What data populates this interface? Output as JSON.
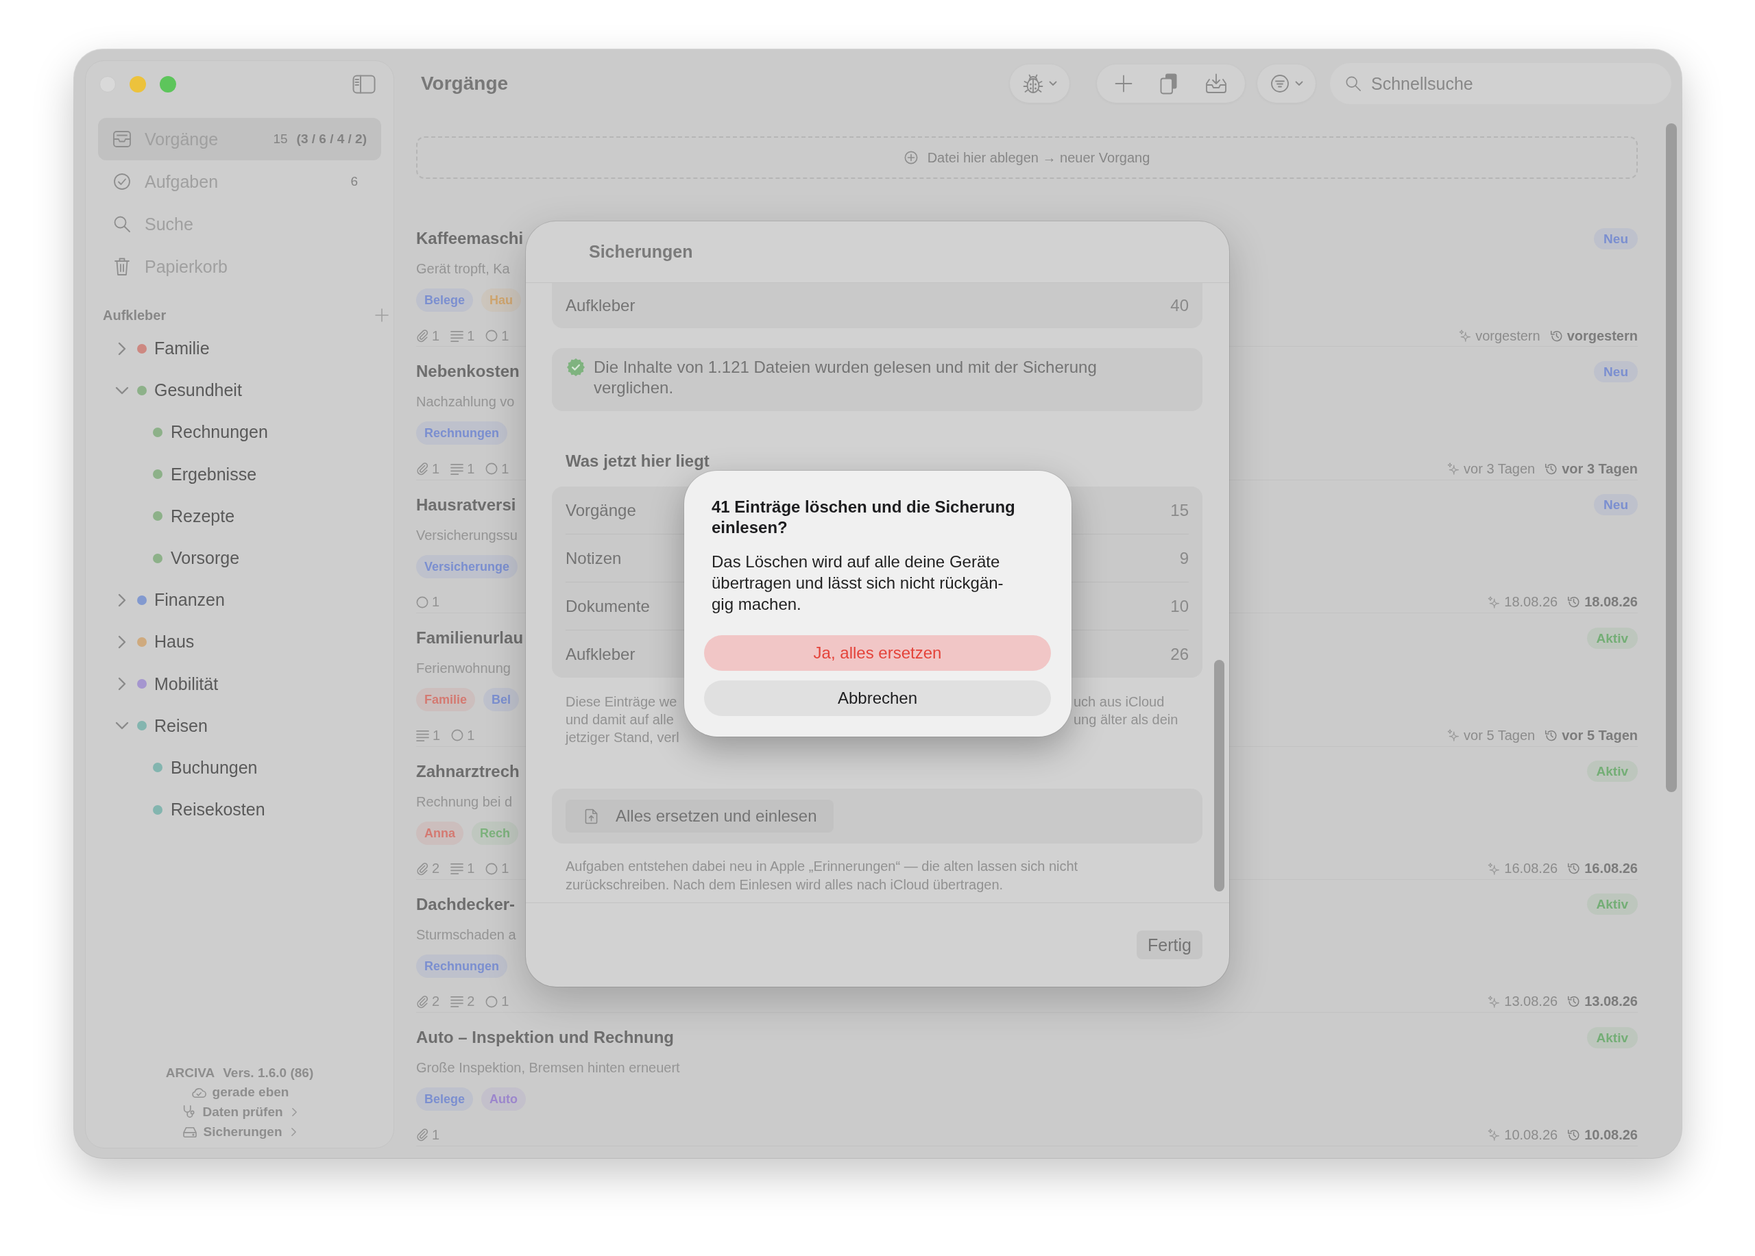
{
  "sidebar": {
    "nav": [
      {
        "label": "Vorgänge",
        "selected": true,
        "count": "15",
        "breakdown": "(3 / 6 / 4 / 2)"
      },
      {
        "label": "Aufgaben",
        "selected": false,
        "count": "6"
      },
      {
        "label": "Suche",
        "selected": false
      },
      {
        "label": "Papierkorb",
        "selected": false
      }
    ],
    "labels_title": "Aufkleber",
    "labels": [
      {
        "name": "Familie",
        "color": "#cd8881",
        "expanded": false
      },
      {
        "name": "Gesundheit",
        "color": "#8db189",
        "expanded": true,
        "children": [
          {
            "name": "Rechnungen",
            "color": "#8db189"
          },
          {
            "name": "Ergebnisse",
            "color": "#8db189"
          },
          {
            "name": "Rezepte",
            "color": "#8db189"
          },
          {
            "name": "Vorsorge",
            "color": "#8db189"
          }
        ]
      },
      {
        "name": "Finanzen",
        "color": "#8299cf",
        "expanded": false
      },
      {
        "name": "Haus",
        "color": "#cfaa7e",
        "expanded": false
      },
      {
        "name": "Mobilität",
        "color": "#a596cf",
        "expanded": false
      },
      {
        "name": "Reisen",
        "color": "#83b5af",
        "expanded": true,
        "children": [
          {
            "name": "Buchungen",
            "color": "#83b5af"
          },
          {
            "name": "Reisekosten",
            "color": "#83b5af"
          }
        ]
      }
    ],
    "footer": {
      "app": "ARCIVA",
      "version": "Vers. 1.6.0 (86)",
      "sync": "gerade eben",
      "links": [
        "Daten prüfen",
        "Sicherungen"
      ]
    }
  },
  "toolbar": {
    "title": "Vorgänge",
    "search": {
      "placeholder": "Schnellsuche"
    }
  },
  "drop_zone": {
    "label": "Datei hier ablegen → neuer Vorgang"
  },
  "items": [
    {
      "title": "Kaffeemaschi",
      "subtitle": "Gerät tropft, Ka",
      "tags": [
        {
          "label": "Belege",
          "color": "#7b8fd0"
        },
        {
          "label": "Hau",
          "color": "#d0a66f"
        }
      ],
      "meta": [
        {
          "kind": "attachments",
          "count": "1"
        },
        {
          "kind": "notes",
          "count": "1"
        },
        {
          "kind": "tasks",
          "count": "1"
        }
      ],
      "badge": {
        "label": "Neu",
        "color": "#7b8fd0"
      },
      "created": "vorgestern",
      "modified": "vorgestern"
    },
    {
      "title": "Nebenkosten",
      "subtitle": "Nachzahlung vo",
      "tags": [
        {
          "label": "Rechnungen",
          "color": "#7b8fd0"
        }
      ],
      "meta": [
        {
          "kind": "attachments",
          "count": "1"
        },
        {
          "kind": "notes",
          "count": "1"
        },
        {
          "kind": "tasks",
          "count": "1"
        }
      ],
      "badge": {
        "label": "Neu",
        "color": "#7b8fd0"
      },
      "created": "vor 3 Tagen",
      "modified": "vor 3 Tagen"
    },
    {
      "title": "Hausratversi",
      "subtitle": "Versicherungssu",
      "tags": [
        {
          "label": "Versicherunge",
          "color": "#7b8fd0"
        }
      ],
      "meta": [
        {
          "kind": "tasks",
          "count": "1"
        }
      ],
      "badge": {
        "label": "Neu",
        "color": "#7b8fd0"
      },
      "created": "18.08.26",
      "modified": "18.08.26"
    },
    {
      "title": "Familienurlau",
      "subtitle": "Ferienwohnung",
      "tags": [
        {
          "label": "Familie",
          "color": "#d47a72"
        },
        {
          "label": "Bel",
          "color": "#7b8fd0"
        }
      ],
      "meta": [
        {
          "kind": "notes",
          "count": "1"
        },
        {
          "kind": "tasks",
          "count": "1"
        }
      ],
      "badge": {
        "label": "Aktiv",
        "color": "#74ae76"
      },
      "created": "vor 5 Tagen",
      "modified": "vor 5 Tagen"
    },
    {
      "title": "Zahnarztrech",
      "subtitle": "Rechnung bei d",
      "tags": [
        {
          "label": "Anna",
          "color": "#d47a72"
        },
        {
          "label": "Rech",
          "color": "#7db27d"
        }
      ],
      "meta": [
        {
          "kind": "attachments",
          "count": "2"
        },
        {
          "kind": "notes",
          "count": "1"
        },
        {
          "kind": "tasks",
          "count": "1"
        }
      ],
      "badge": {
        "label": "Aktiv",
        "color": "#74ae76"
      },
      "created": "16.08.26",
      "modified": "16.08.26"
    },
    {
      "title": "Dachdecker-",
      "subtitle": "Sturmschaden a",
      "tags": [
        {
          "label": "Rechnungen",
          "color": "#7b8fd0"
        }
      ],
      "meta": [
        {
          "kind": "attachments",
          "count": "2"
        },
        {
          "kind": "notes",
          "count": "2"
        },
        {
          "kind": "tasks",
          "count": "1"
        }
      ],
      "badge": {
        "label": "Aktiv",
        "color": "#74ae76"
      },
      "created": "13.08.26",
      "modified": "13.08.26"
    },
    {
      "title": "Auto – Inspektion und Rechnung",
      "subtitle": "Große Inspektion, Bremsen hinten erneuert",
      "tags": [
        {
          "label": "Belege",
          "color": "#7b8fd0"
        },
        {
          "label": "Auto",
          "color": "#9c86cc"
        }
      ],
      "meta": [
        {
          "kind": "attachments",
          "count": "1"
        }
      ],
      "badge": {
        "label": "Aktiv",
        "color": "#74ae76"
      },
      "created": "10.08.26",
      "modified": "10.08.26"
    }
  ],
  "sheet": {
    "title": "Sicherungen",
    "top_rows": [
      {
        "label": "Aufkleber",
        "value": "40"
      }
    ],
    "verified": "Die Inhalte von 1.121 Dateien wurden gelesen und mit der Sicherung verglichen.",
    "section": "Was jetzt hier liegt",
    "rows": [
      {
        "label": "Vorgänge",
        "value": "15"
      },
      {
        "label": "Notizen",
        "value": "9"
      },
      {
        "label": "Dokumente",
        "value": "10"
      },
      {
        "label": "Aufkleber",
        "value": "26"
      }
    ],
    "note_lines": [
      {
        "left": "Diese Einträge we",
        "right": "uch aus iCloud"
      },
      {
        "left": "und damit auf alle",
        "right": "ung älter als dein"
      },
      {
        "left": "jetziger Stand, verl"
      }
    ],
    "action": "Alles ersetzen und einlesen",
    "note": "Aufgaben entstehen dabei neu in Apple „Erinnerungen“ — die alten lassen sich nicht zurückschreiben. Nach dem Einlesen wird alles nach iCloud übertragen.",
    "done": "Fertig"
  },
  "alert": {
    "title": "41 Einträge löschen und die Sicherung einlesen?",
    "message": "Das Löschen wird auf alle deine Geräte übertragen und lässt sich nicht rückgän-gig machen.",
    "buttons": [
      {
        "label": "Ja, alles ersetzen",
        "kind": "destructive"
      },
      {
        "label": "Abbrechen",
        "kind": "cancel"
      }
    ]
  }
}
